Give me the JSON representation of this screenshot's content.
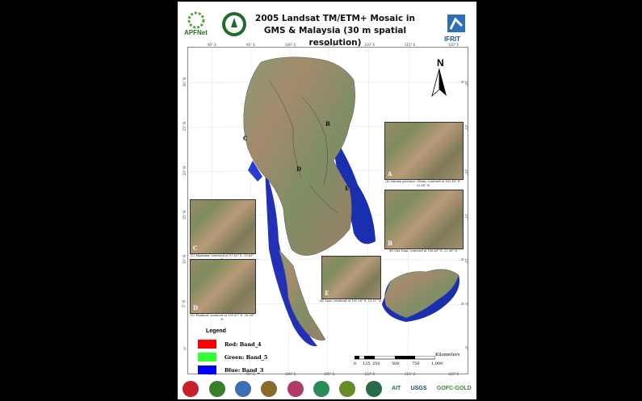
{
  "header": {
    "title": "2005 Landsat TM/ETM+ Mosaic in GMS & Malaysia (30 m spatial resolution)",
    "logo_left": "APFNet",
    "logo_right": "IFRIT"
  },
  "map": {
    "north_label": "N",
    "top_ticks": [
      "90° E",
      "95° E",
      "100° E",
      "105° E",
      "110° E",
      "115° E",
      "120° E"
    ],
    "bottom_ticks": [
      "90° E",
      "95° E",
      "100° E",
      "105° E",
      "110° E",
      "115° E",
      "120° E"
    ],
    "left_ticks": [
      "30° N",
      "25° N",
      "20° N",
      "15° N",
      "10° N",
      "5° N",
      "0°"
    ],
    "right_ticks": [
      "30° N",
      "25° N",
      "20° N",
      "15° N",
      "10° N",
      "5° N",
      "0°"
    ],
    "region_letters": [
      "A",
      "B",
      "C",
      "D",
      "E"
    ]
  },
  "insets": [
    {
      "letter": "A",
      "caption": "(A) Yunnan province, China, centered at 102.45° E, 22.85° N"
    },
    {
      "letter": "B",
      "caption": "(B) Viet Nam, centered at 106.69° E, 22.06° N"
    },
    {
      "letter": "C",
      "caption": "(C) Myanmar, centered at 97.82° E, 19.61° N"
    },
    {
      "letter": "D",
      "caption": "(D) Thailand, centered at 101.87° E, 16.94° N"
    },
    {
      "letter": "E",
      "caption": "(E) Laos, centered at 101.26° E, 15.11° N"
    }
  ],
  "legend": {
    "title": "Legend",
    "items": [
      {
        "label": "Red:   Band_4",
        "color": "#ff0000"
      },
      {
        "label": "Green: Band_5",
        "color": "#33ff33"
      },
      {
        "label": "Blue:  Band_3",
        "color": "#0000ff"
      }
    ]
  },
  "scale": {
    "unit": "Kilometers",
    "ticks": [
      "0",
      "125",
      "250",
      "500",
      "750",
      "1,000"
    ]
  },
  "footer": {
    "logos": [
      "AIT",
      "USGS",
      "GOFC-GOLD"
    ]
  }
}
